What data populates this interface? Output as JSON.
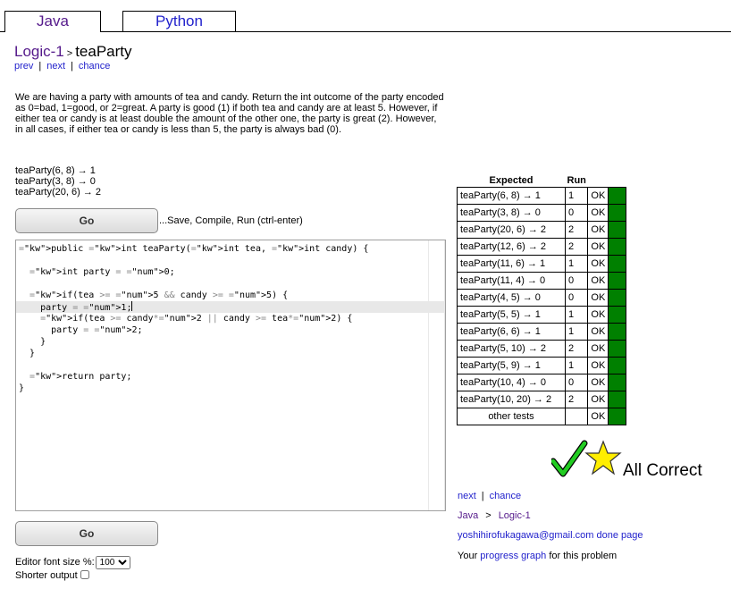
{
  "tabs": [
    {
      "label": "Java",
      "active": true
    },
    {
      "label": "Python",
      "active": false
    }
  ],
  "breadcrumb": {
    "section": "Logic-1",
    "separator": ">",
    "problem": "teaParty"
  },
  "subnav": {
    "prev": "prev",
    "next": "next",
    "chance": "chance"
  },
  "description": "We are having a party with amounts of tea and candy. Return the int outcome of the party encoded as 0=bad, 1=good, or 2=great. A party is good (1) if both tea and candy are at least 5. However, if either tea or candy is at least double the amount of the other one, the party is great (2). However, in all cases, if either tea or candy is less than 5, the party is always bad (0).",
  "examples": [
    "teaParty(6, 8) → 1",
    "teaParty(3, 8) → 0",
    "teaParty(20, 6) → 2"
  ],
  "go_button": "Go",
  "go_hint": "...Save, Compile, Run (ctrl-enter)",
  "editor_lines": [
    "public int teaParty(int tea, int candy) {",
    "",
    "  int party = 0;",
    "",
    "  if(tea >= 5 && candy >= 5) {",
    "    party = 1;",
    "    if(tea >= candy*2 || candy >= tea*2) {",
    "      party = 2;",
    "    }",
    "  }",
    "",
    "  return party;",
    "}"
  ],
  "results": {
    "headers": {
      "expected": "Expected",
      "run": "Run"
    },
    "rows": [
      {
        "expected": "teaParty(6, 8) → 1",
        "run": "1",
        "status": "OK"
      },
      {
        "expected": "teaParty(3, 8) → 0",
        "run": "0",
        "status": "OK"
      },
      {
        "expected": "teaParty(20, 6) → 2",
        "run": "2",
        "status": "OK"
      },
      {
        "expected": "teaParty(12, 6) → 2",
        "run": "2",
        "status": "OK"
      },
      {
        "expected": "teaParty(11, 6) → 1",
        "run": "1",
        "status": "OK"
      },
      {
        "expected": "teaParty(11, 4) → 0",
        "run": "0",
        "status": "OK"
      },
      {
        "expected": "teaParty(4, 5) → 0",
        "run": "0",
        "status": "OK"
      },
      {
        "expected": "teaParty(5, 5) → 1",
        "run": "1",
        "status": "OK"
      },
      {
        "expected": "teaParty(6, 6) → 1",
        "run": "1",
        "status": "OK"
      },
      {
        "expected": "teaParty(5, 10) → 2",
        "run": "2",
        "status": "OK"
      },
      {
        "expected": "teaParty(5, 9) → 1",
        "run": "1",
        "status": "OK"
      },
      {
        "expected": "teaParty(10, 4) → 0",
        "run": "0",
        "status": "OK"
      },
      {
        "expected": "teaParty(10, 20) → 2",
        "run": "2",
        "status": "OK"
      },
      {
        "expected": "other tests",
        "run": "",
        "status": "OK"
      }
    ],
    "pass_color": "#008000"
  },
  "all_correct": "All Correct",
  "right_nav": {
    "next": "next",
    "chance": "chance",
    "lang": "Java",
    "section": "Logic-1",
    "user_email": "yoshihirofukagawa@gmail.com",
    "done_page": "done page",
    "progress_prefix": "Your ",
    "progress_link": "progress graph",
    "progress_suffix": " for this problem"
  },
  "editor_font": {
    "label": "Editor font size %:",
    "value": "100"
  },
  "shorter_output": {
    "label": "Shorter output",
    "checked": false
  }
}
